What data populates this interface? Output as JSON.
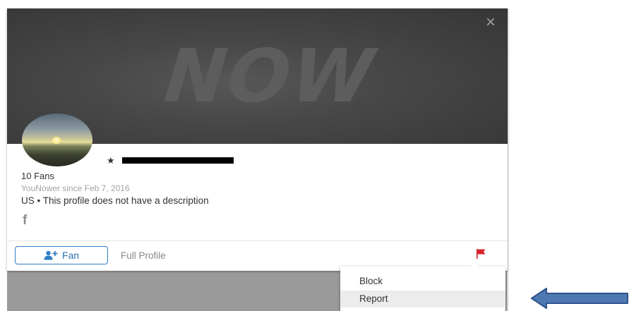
{
  "banner": {
    "watermark": "NOW",
    "close_label": "×"
  },
  "profile": {
    "star": "★",
    "fans": "10 Fans",
    "since": "YouNower since Feb 7, 2016",
    "location_description": "US • This profile does not have a description",
    "social_icon": "facebook-icon",
    "social_glyph": "f"
  },
  "actions": {
    "fan_label": "Fan",
    "full_profile_label": "Full Profile",
    "flag_icon": "flag-icon"
  },
  "menu": {
    "items": [
      "Block",
      "Report"
    ],
    "highlighted": "Report"
  },
  "colors": {
    "accent_blue": "#2f7fc7",
    "flag_red": "#d4242a",
    "arrow_fill": "#4e79b0",
    "arrow_stroke": "#2f528f",
    "banner_dark": "#474747"
  }
}
